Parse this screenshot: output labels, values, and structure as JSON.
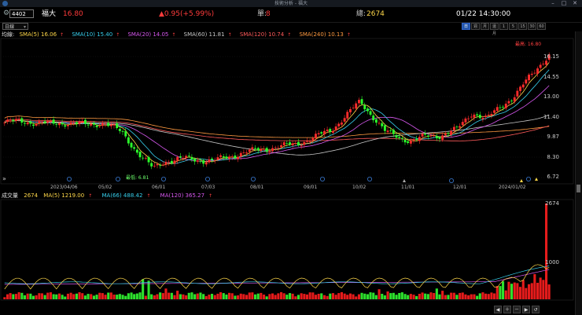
{
  "window": {
    "title": "技術分析 - 福大"
  },
  "quote": {
    "code": "4402",
    "name": "福大",
    "price": "16.80",
    "change": "▲0.95(+5.99%)",
    "single_label": "單:",
    "single_value": "8",
    "total_label": "總:",
    "total_value": "2674",
    "datetime": "01/22 14:30:00"
  },
  "toolbar": {
    "period": "日線",
    "timeframes": [
      "日",
      "週",
      "月",
      "還月",
      "1",
      "5",
      "15",
      "30",
      "60"
    ]
  },
  "ma_legend": {
    "label": "均線:",
    "items": [
      {
        "text": "SMA(5) 16.06",
        "color": "#ffd84a"
      },
      {
        "text": "SMA(10) 15.40",
        "color": "#37d0ee"
      },
      {
        "text": "SMA(20) 14.05",
        "color": "#d858f0"
      },
      {
        "text": "SMA(60) 11.81",
        "color": "#c8c8c8"
      },
      {
        "text": "SMA(120) 10.74",
        "color": "#ff5a5a"
      },
      {
        "text": "SMA(240) 10.13",
        "color": "#ff9a40"
      }
    ]
  },
  "vol_legend": {
    "label": "成交量",
    "value": "2674",
    "items": [
      {
        "text": "MA(5) 1219.00",
        "color": "#ffd84a"
      },
      {
        "text": "MA(66) 488.42",
        "color": "#37d0ee"
      },
      {
        "text": "MA(120) 365.27",
        "color": "#d858f0"
      }
    ]
  },
  "price_axis": [
    "16.15",
    "14.55",
    "13.00",
    "11.40",
    "9.87",
    "8.30",
    "6.72"
  ],
  "volume_axis": [
    "2674",
    "1000"
  ],
  "date_axis": [
    "2023/04/06",
    "05/02",
    "06/01",
    "07/03",
    "08/01",
    "09/01",
    "10/02",
    "11/01",
    "12/01",
    "2024/01/02"
  ],
  "annotations": {
    "high": "最高: 16.80",
    "low": "最低: 6.81"
  }
}
